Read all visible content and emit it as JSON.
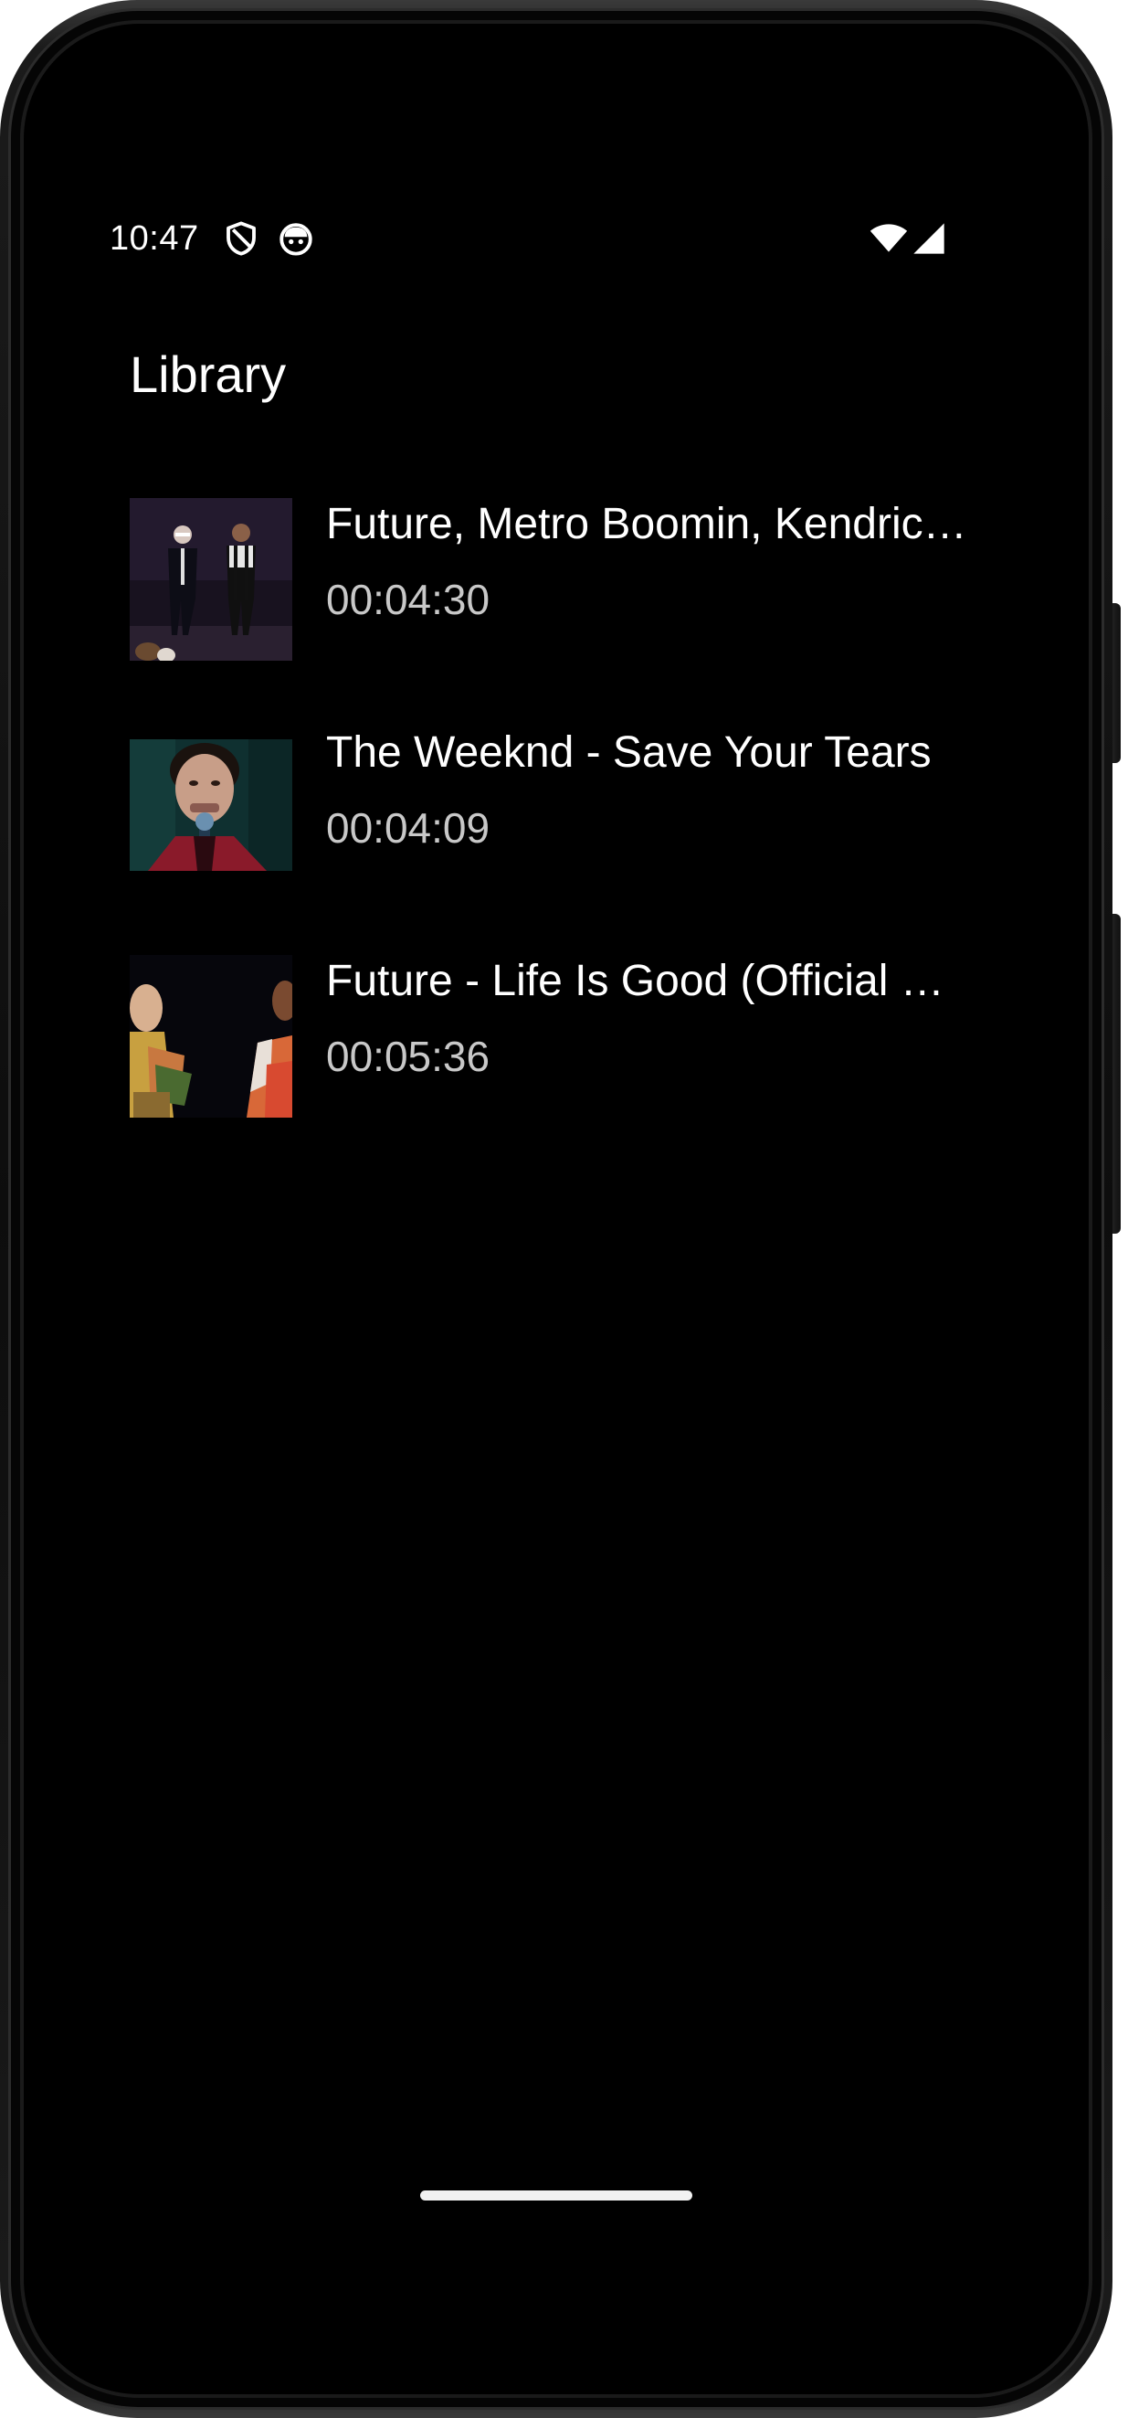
{
  "status_bar": {
    "time": "10:47",
    "icons": [
      "shield-icon",
      "robot-icon",
      "wifi-icon",
      "cell-signal-icon"
    ]
  },
  "app": {
    "title": "Library"
  },
  "tracks": [
    {
      "title": "Future, Metro Boomin, Kendrick Lamar - Like That",
      "duration": "00:04:30",
      "thumbnail": "video-thumbnail-1"
    },
    {
      "title": "The Weeknd - Save Your Tears",
      "duration": "00:04:09",
      "thumbnail": "video-thumbnail-2"
    },
    {
      "title": "Future - Life Is Good (Official Music Video)",
      "duration": "00:05:36",
      "thumbnail": "video-thumbnail-3"
    }
  ],
  "colors": {
    "background": "#000000",
    "primary_text": "#ffffff",
    "secondary_text": "#c8c8c8",
    "device_frame": "#0d0d0d"
  }
}
